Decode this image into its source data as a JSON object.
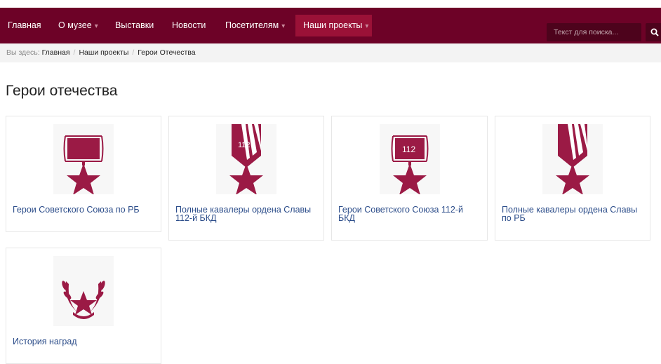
{
  "nav": {
    "items": [
      {
        "label": "Главная",
        "dropdown": false,
        "active": false
      },
      {
        "label": "О музее",
        "dropdown": true,
        "active": false
      },
      {
        "label": "Выставки",
        "dropdown": false,
        "active": false
      },
      {
        "label": "Новости",
        "dropdown": false,
        "active": false
      },
      {
        "label": "Посетителям",
        "dropdown": true,
        "active": false
      },
      {
        "label": "Наши проекты",
        "dropdown": true,
        "active": true
      }
    ],
    "search_placeholder": "Текст для поиска...",
    "search_icon": "search-icon"
  },
  "breadcrumb": {
    "prefix": "Вы здесь:",
    "items": [
      "Главная",
      "Наши проекты",
      "Герои Отечества"
    ],
    "separator": "/"
  },
  "page": {
    "title": "Герои отечества"
  },
  "cards": [
    {
      "title": "Герои Советского Союза по РБ",
      "icon": "gold-star-medal-icon"
    },
    {
      "title": "Полные кавалеры ордена Славы 112-й БКД",
      "icon": "order-of-glory-112-icon",
      "badge": "112"
    },
    {
      "title": "Герои Советского Союза 112-й БКД",
      "icon": "gold-star-medal-112-icon",
      "badge": "112"
    },
    {
      "title": "Полные кавалеры ордена Славы по РБ",
      "icon": "order-of-glory-icon"
    },
    {
      "title": "История наград",
      "icon": "star-laurel-wreath-icon"
    }
  ],
  "colors": {
    "navbar": "#6d0227",
    "nav_active": "#9a1137",
    "icon": "#9b1a45",
    "link": "#2c4d8a"
  }
}
